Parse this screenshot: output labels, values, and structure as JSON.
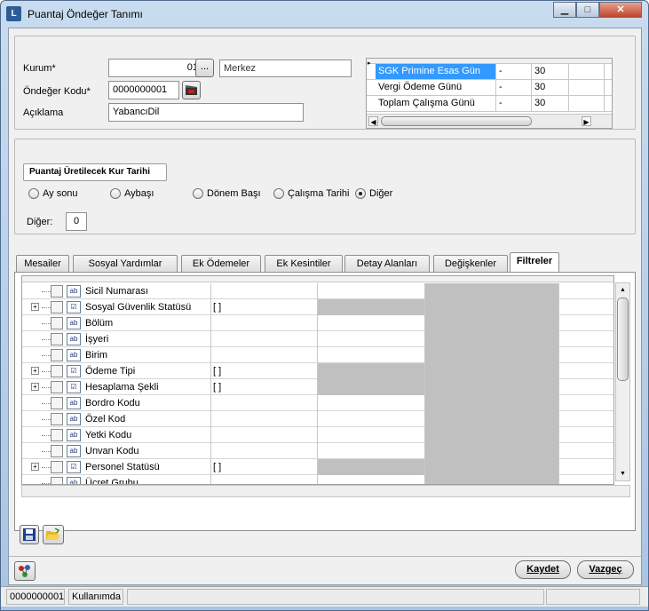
{
  "window": {
    "title": "Puantaj Öndeğer Tanımı",
    "min": "▁",
    "max": "□",
    "close": "✕"
  },
  "form": {
    "kurum_label": "Kurum*",
    "kurum_value": "01",
    "kurum_browse": "...",
    "kurum_name": "Merkez",
    "ondeger_label": "Öndeğer Kodu*",
    "ondeger_value": "0000000001",
    "aciklama_label": "Açıklama",
    "aciklama_value": "YabancıDil"
  },
  "days_grid": {
    "rows": [
      {
        "name": "SGK Primine Esas Gün",
        "op": "-",
        "value": "30",
        "selected": true
      },
      {
        "name": "Vergi Ödeme Günü",
        "op": "-",
        "value": "30"
      },
      {
        "name": "Toplam Çalışma Günü",
        "op": "-",
        "value": "30"
      }
    ]
  },
  "kur_tarihi": {
    "group_label": "Puantaj Üretilecek Kur Tarihi",
    "options": [
      "Ay sonu",
      "Aybaşı",
      "Dönem Başı",
      "Çalışma Tarihi",
      "Diğer"
    ],
    "selected": "Diğer",
    "diger_label": "Diğer:",
    "diger_value": "0"
  },
  "tabs": [
    "Mesailer",
    "Sosyal Yardımlar",
    "Ek Ödemeler",
    "Ek Kesintiler",
    "Detay Alanları",
    "Değişkenler",
    "Filtreler"
  ],
  "active_tab": "Filtreler",
  "filters": [
    {
      "label": "Sicil Numarası",
      "type": "text",
      "value": "",
      "expand": false,
      "shaded": false
    },
    {
      "label": "Sosyal Güvenlik Statüsü",
      "type": "list",
      "value": "[ ]",
      "expand": true,
      "shaded": true
    },
    {
      "label": "Bölüm",
      "type": "text",
      "value": "",
      "expand": false,
      "shaded": false
    },
    {
      "label": "İşyeri",
      "type": "text",
      "value": "",
      "expand": false,
      "shaded": false
    },
    {
      "label": "Birim",
      "type": "text",
      "value": "",
      "expand": false,
      "shaded": false
    },
    {
      "label": "Ödeme Tipi",
      "type": "list",
      "value": "[ ]",
      "expand": true,
      "shaded": true
    },
    {
      "label": "Hesaplama Şekli",
      "type": "list",
      "value": "[ ]",
      "expand": true,
      "shaded": true
    },
    {
      "label": "Bordro Kodu",
      "type": "text",
      "value": "",
      "expand": false,
      "shaded": false
    },
    {
      "label": "Özel Kod",
      "type": "text",
      "value": "",
      "expand": false,
      "shaded": false
    },
    {
      "label": "Yetki Kodu",
      "type": "text",
      "value": "",
      "expand": false,
      "shaded": false
    },
    {
      "label": "Unvan Kodu",
      "type": "text",
      "value": "",
      "expand": false,
      "shaded": false
    },
    {
      "label": "Personel Statüsü",
      "type": "list",
      "value": "[ ]",
      "expand": true,
      "shaded": true
    },
    {
      "label": "Ücret Grubu",
      "type": "text",
      "value": "",
      "expand": false,
      "shaded": false
    }
  ],
  "icons": {
    "text_type": "ab",
    "list_type": "☑"
  },
  "buttons": {
    "save": "Kaydet",
    "cancel": "Vazgeç"
  },
  "status": {
    "code": "0000000001",
    "state": "Kullanımda"
  }
}
